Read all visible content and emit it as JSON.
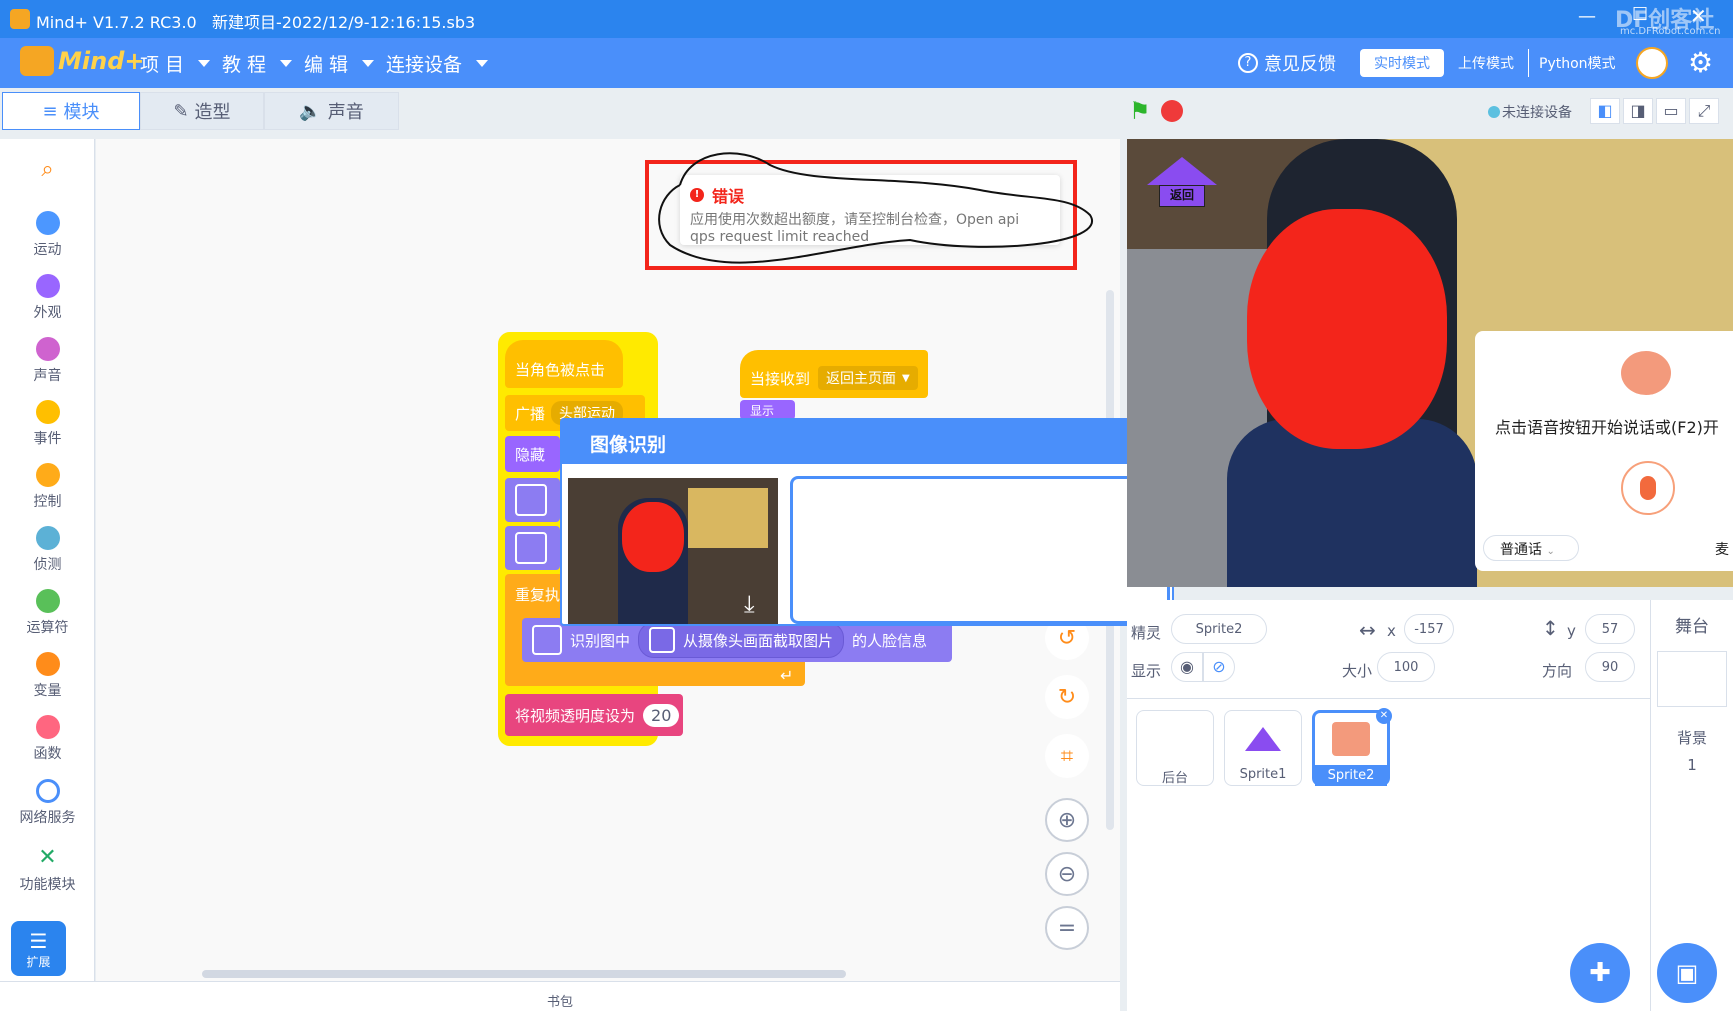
{
  "window": {
    "title": "Mind+ V1.7.2 RC3.0   新建项目-2022/12/9-12:16:15.sb3",
    "watermark": "DF创客社区",
    "watermark_sub": "mc.DFRobot.com.cn"
  },
  "menubar": {
    "logo": "Mind+",
    "items": [
      "项 目",
      "教 程",
      "编 辑",
      "连接设备"
    ],
    "feedback": "意见反馈",
    "modes": [
      "实时模式",
      "上传模式",
      "Python模式"
    ]
  },
  "tabs": [
    "模块",
    "造型",
    "声音"
  ],
  "categories": [
    {
      "label": "运动",
      "color": "#4c97ff"
    },
    {
      "label": "外观",
      "color": "#9966ff"
    },
    {
      "label": "声音",
      "color": "#cf63cf"
    },
    {
      "label": "事件",
      "color": "#ffbf00"
    },
    {
      "label": "控制",
      "color": "#ffab19"
    },
    {
      "label": "侦测",
      "color": "#5cb1d6"
    },
    {
      "label": "运算符",
      "color": "#59c059"
    },
    {
      "label": "变量",
      "color": "#ff8c1a"
    },
    {
      "label": "函数",
      "color": "#ff6680"
    },
    {
      "label": "网络服务",
      "color": "#4a8ffa"
    },
    {
      "label": "功能模块",
      "color": "#22aa66"
    }
  ],
  "extension_label": "扩展",
  "error": {
    "title": "错误",
    "message_line1": "应用使用次数超出额度，请至控制台检查，Open api",
    "message_line2": "qps request limit reached"
  },
  "blocks": {
    "hat1": "当角色被点击",
    "broadcast": "广播",
    "broadcast_value": "头部运动",
    "hide": "隐藏",
    "repeat": "重复执行",
    "recognize_prefix": "识别图中",
    "recognize_source": "从摄像头画面截取图片",
    "recognize_suffix": "的人脸信息",
    "transparency": "将视频透明度设为",
    "transparency_value": "20",
    "hat2": "当接收到",
    "hat2_value": "返回主页面",
    "show": "显示"
  },
  "dialog": {
    "title": "图像识别"
  },
  "bottom": {
    "backpack": "书包"
  },
  "stage": {
    "status": "未连接设备",
    "return_label": "返回",
    "voice_prompt": "点击语音按钮开始说话或(F2)开",
    "voice_lang": "普通话",
    "voice_more": "麦"
  },
  "sprite_info": {
    "name_label": "精灵",
    "name": "Sprite2",
    "x_label": "x",
    "x": "-157",
    "y_label": "y",
    "y": "57",
    "show_label": "显示",
    "size_label": "大小",
    "size": "100",
    "direction_label": "方向",
    "direction": "90"
  },
  "sprites": [
    "后台",
    "Sprite1",
    "Sprite2"
  ],
  "stage_panel": {
    "title": "舞台",
    "backdrop_label": "背景",
    "backdrop_count": "1"
  }
}
